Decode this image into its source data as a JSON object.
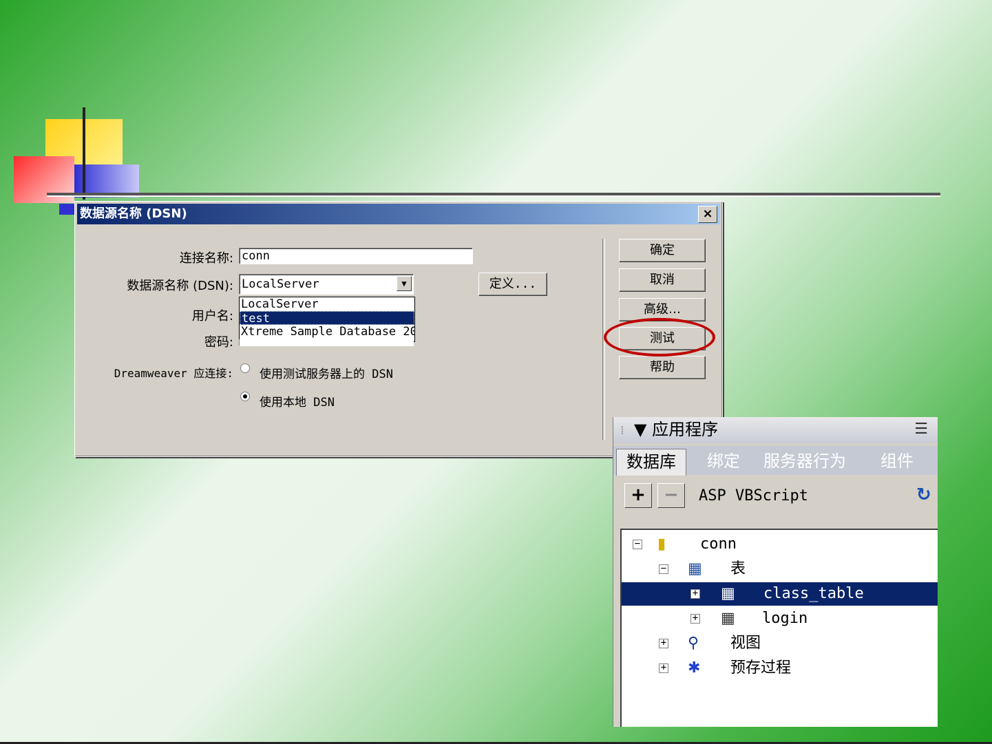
{
  "dialog": {
    "title": "数据源名称 (DSN)",
    "close": "×",
    "fields": {
      "connection_label": "连接名称:",
      "connection_value": "conn",
      "dsn_label": "数据源名称 (DSN):",
      "dsn_value": "LocalServer",
      "dsn_options": [
        "LocalServer",
        "test",
        "Xtreme Sample Database 20"
      ],
      "dsn_selected_option": "test",
      "user_label": "用户名:",
      "password_label": "密码:",
      "connect_label": "Dreamweaver 应连接:",
      "radio_server": "使用测试服务器上的 DSN",
      "radio_local": "使用本地 DSN"
    },
    "define_button": "定义...",
    "buttons": {
      "ok": "确定",
      "cancel": "取消",
      "advanced": "高级…",
      "test": "测试",
      "help": "帮助"
    },
    "highlight_color": "#c00000"
  },
  "panel": {
    "title": "▼ 应用程序",
    "tabs": [
      "数据库",
      "绑定",
      "服务器行为",
      "组件"
    ],
    "server_model": "ASP VBScript",
    "tree": {
      "root": "conn",
      "tables": "表",
      "table_items": [
        "class_table",
        "login"
      ],
      "views": "视图",
      "procedures": "预存过程"
    }
  },
  "colors": {
    "title_start": "#0a246a",
    "title_end": "#a6caf0",
    "selection": "#0a246a"
  }
}
